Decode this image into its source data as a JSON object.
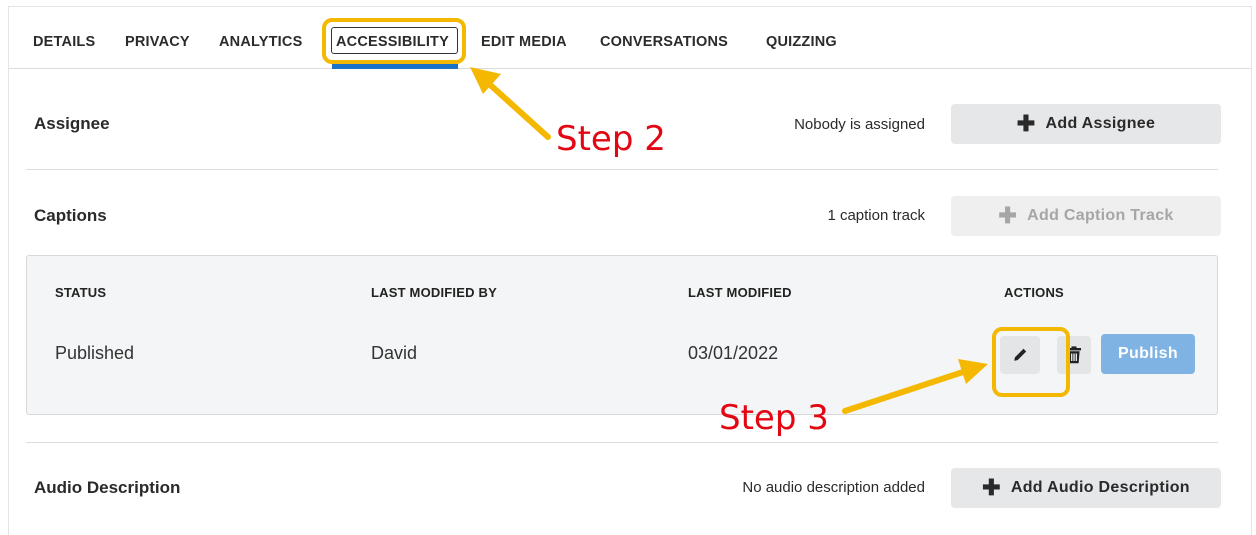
{
  "tabs": [
    {
      "label": "DETAILS"
    },
    {
      "label": "PRIVACY"
    },
    {
      "label": "ANALYTICS"
    },
    {
      "label": "ACCESSIBILITY",
      "active": true
    },
    {
      "label": "EDIT MEDIA"
    },
    {
      "label": "CONVERSATIONS"
    },
    {
      "label": "QUIZZING"
    }
  ],
  "assignee": {
    "title": "Assignee",
    "status": "Nobody is assigned",
    "button": "Add Assignee"
  },
  "captions": {
    "title": "Captions",
    "status": "1 caption track",
    "button": "Add Caption Track",
    "table": {
      "headers": [
        "STATUS",
        "LAST MODIFIED BY",
        "LAST MODIFIED",
        "ACTIONS"
      ],
      "row": {
        "status": "Published",
        "modified_by": "David",
        "modified": "03/01/2022"
      },
      "actions": {
        "edit_icon": "pencil-icon",
        "delete_icon": "trash-icon",
        "publish": "Publish"
      }
    }
  },
  "audio_description": {
    "title": "Audio Description",
    "status": "No audio description added",
    "button": "Add Audio Description"
  },
  "annotations": {
    "step2": "Step 2",
    "step3": "Step 3",
    "highlight_color": "#f5b800",
    "text_color": "#e30613"
  },
  "colors": {
    "accent": "#1a73c6",
    "publish_button": "#7fb3e3"
  }
}
